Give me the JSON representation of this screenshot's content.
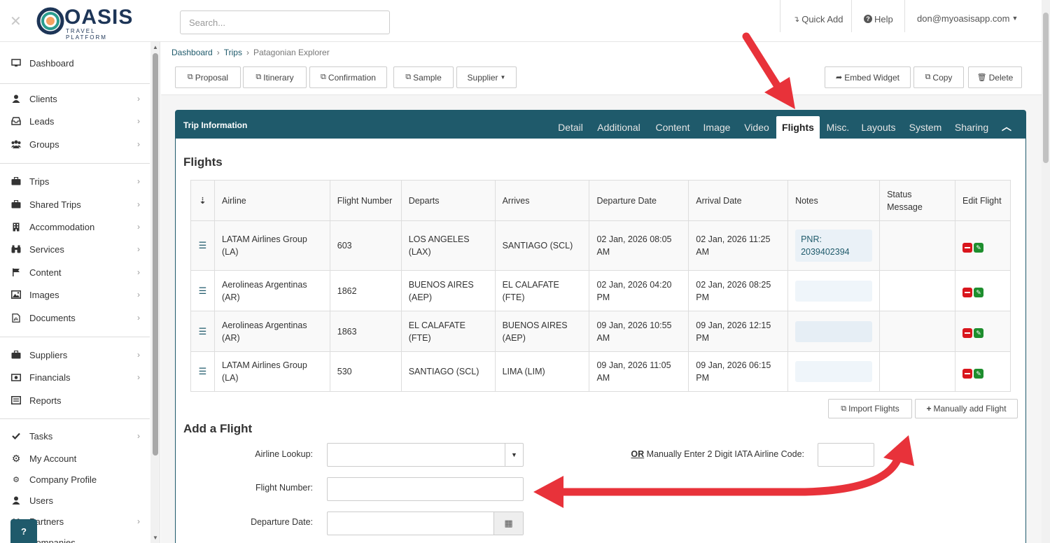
{
  "app": {
    "logo_text": "OASIS",
    "logo_sub": "TRAVEL PLATFORM",
    "search_placeholder": "Search...",
    "quick_add": "Quick Add",
    "help": "Help",
    "user_email": "don@myoasisapp.com",
    "help_button": "?"
  },
  "sidebar": {
    "items": [
      {
        "label": "Dashboard",
        "icon": "monitor-icon"
      },
      {
        "label": "Clients",
        "icon": "user-icon"
      },
      {
        "label": "Leads",
        "icon": "inbox-icon"
      },
      {
        "label": "Groups",
        "icon": "users-icon"
      },
      {
        "label": "Trips",
        "icon": "suitcase-icon"
      },
      {
        "label": "Shared Trips",
        "icon": "suitcase-icon"
      },
      {
        "label": "Accommodation",
        "icon": "building-icon"
      },
      {
        "label": "Services",
        "icon": "binoculars-icon"
      },
      {
        "label": "Content",
        "icon": "flag-icon"
      },
      {
        "label": "Images",
        "icon": "image-icon"
      },
      {
        "label": "Documents",
        "icon": "pdf-icon"
      },
      {
        "label": "Suppliers",
        "icon": "suitcase-icon"
      },
      {
        "label": "Financials",
        "icon": "money-icon"
      },
      {
        "label": "Reports",
        "icon": "list-icon"
      },
      {
        "label": "Tasks",
        "icon": "check-icon"
      },
      {
        "label": "My Account",
        "icon": "gear-icon"
      },
      {
        "label": "Company Profile",
        "icon": "gears-icon"
      },
      {
        "label": "Users",
        "icon": "user-icon"
      },
      {
        "label": "Partners",
        "icon": "handshake-icon"
      },
      {
        "label": "Companies",
        "icon": "briefcase-icon"
      }
    ]
  },
  "breadcrumb": [
    "Dashboard",
    "Trips",
    "Patagonian Explorer"
  ],
  "toolbar": {
    "proposal": "Proposal",
    "itinerary": "Itinerary",
    "confirmation": "Confirmation",
    "sample": "Sample",
    "supplier": "Supplier",
    "embed": "Embed Widget",
    "copy": "Copy",
    "delete": "Delete"
  },
  "panel": {
    "title": "Trip Information",
    "tabs": [
      "Detail",
      "Additional",
      "Content",
      "Image",
      "Video",
      "Flights",
      "Misc.",
      "Layouts",
      "System",
      "Sharing"
    ],
    "active_tab": "Flights"
  },
  "flights": {
    "heading": "Flights",
    "columns": [
      "Airline",
      "Flight Number",
      "Departs",
      "Arrives",
      "Departure Date",
      "Arrival Date",
      "Notes",
      "Status Message",
      "Edit Flight"
    ],
    "rows": [
      {
        "airline": "LATAM Airlines Group (LA)",
        "number": "603",
        "departs": "LOS ANGELES (LAX)",
        "arrives": "SANTIAGO (SCL)",
        "dep_date": "02 Jan, 2026 08:05 AM",
        "arr_date": "02 Jan, 2026 11:25 AM",
        "notes": "PNR: 2039402394",
        "status": ""
      },
      {
        "airline": "Aerolineas Argentinas (AR)",
        "number": "1862",
        "departs": "BUENOS AIRES (AEP)",
        "arrives": "EL CALAFATE (FTE)",
        "dep_date": "02 Jan, 2026 04:20 PM",
        "arr_date": "02 Jan, 2026 08:25 PM",
        "notes": "",
        "status": ""
      },
      {
        "airline": "Aerolineas Argentinas (AR)",
        "number": "1863",
        "departs": "EL CALAFATE (FTE)",
        "arrives": "BUENOS AIRES (AEP)",
        "dep_date": "09 Jan, 2026 10:55 AM",
        "arr_date": "09 Jan, 2026 12:15 PM",
        "notes": "",
        "status": ""
      },
      {
        "airline": "LATAM Airlines Group (LA)",
        "number": "530",
        "departs": "SANTIAGO (SCL)",
        "arrives": "LIMA (LIM)",
        "dep_date": "09 Jan, 2026 11:05 AM",
        "arr_date": "09 Jan, 2026 06:15 PM",
        "notes": "",
        "status": ""
      }
    ],
    "import_button": "Import Flights",
    "manual_button": "Manually add Flight"
  },
  "add_flight": {
    "heading": "Add a Flight",
    "airline_lookup_label": "Airline Lookup:",
    "or_label": "OR",
    "iata_label": "Manually Enter 2 Digit IATA Airline Code:",
    "flight_number_label": "Flight Number:",
    "departure_date_label": "Departure Date:"
  },
  "colors": {
    "accent": "#1f5a6b",
    "annotation_arrow": "#e8323a"
  }
}
